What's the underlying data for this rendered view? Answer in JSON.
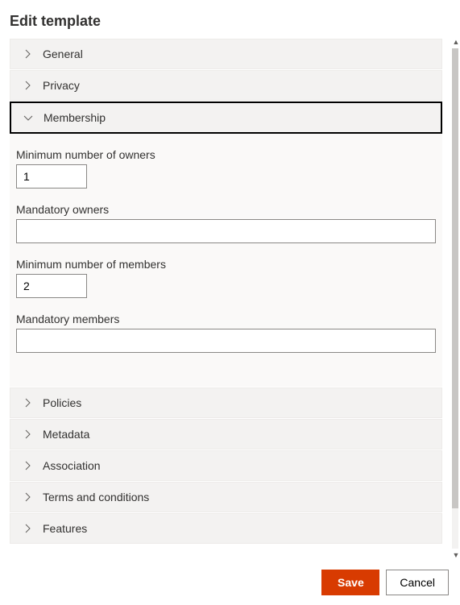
{
  "header": {
    "title": "Edit template"
  },
  "accordion": {
    "general": {
      "label": "General"
    },
    "privacy": {
      "label": "Privacy"
    },
    "membership": {
      "label": "Membership",
      "min_owners_label": "Minimum number of owners",
      "min_owners_value": "1",
      "mandatory_owners_label": "Mandatory owners",
      "mandatory_owners_value": "",
      "min_members_label": "Minimum number of members",
      "min_members_value": "2",
      "mandatory_members_label": "Mandatory members",
      "mandatory_members_value": ""
    },
    "policies": {
      "label": "Policies"
    },
    "metadata": {
      "label": "Metadata"
    },
    "association": {
      "label": "Association"
    },
    "terms": {
      "label": "Terms and conditions"
    },
    "features": {
      "label": "Features"
    }
  },
  "footer": {
    "save_label": "Save",
    "cancel_label": "Cancel"
  }
}
